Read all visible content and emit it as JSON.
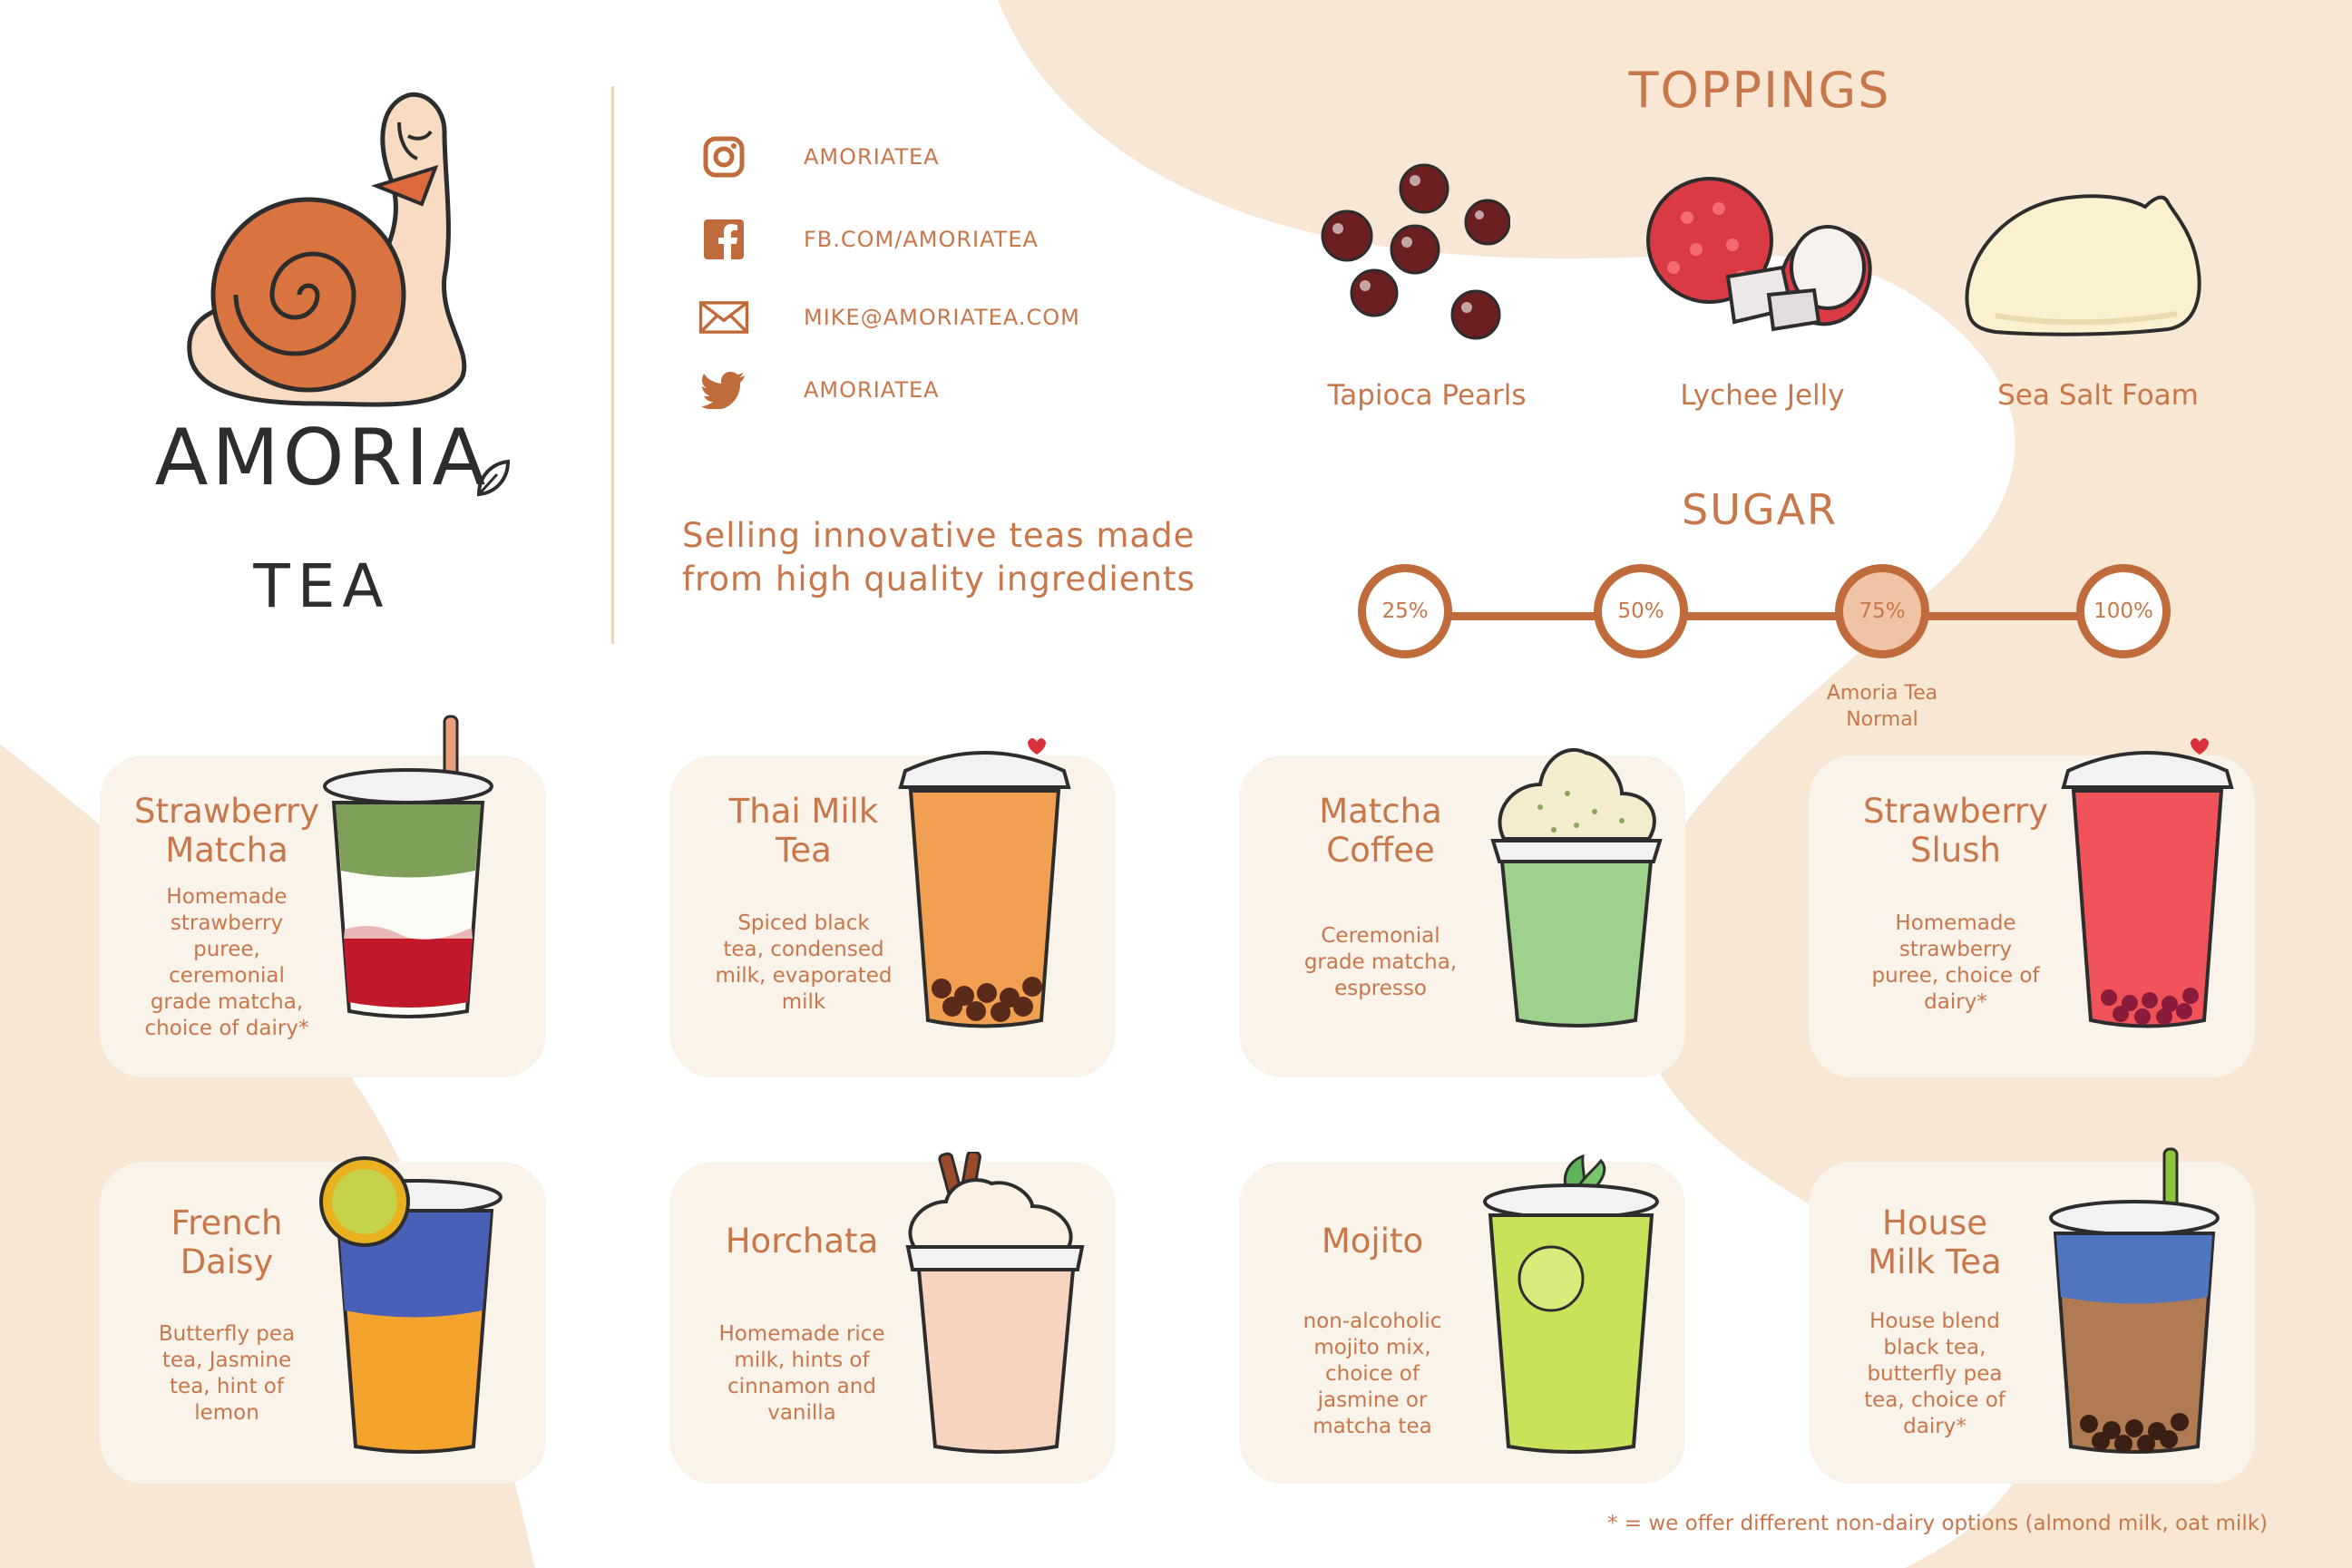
{
  "brand": {
    "name": "AMORIA",
    "sub": "TEA"
  },
  "contacts": {
    "instagram": "AMORIATEA",
    "facebook": "FB.COM/AMORIATEA",
    "email": "MIKE@AMORIATEA.COM",
    "twitter": "AMORIATEA"
  },
  "tagline": {
    "line1": "Selling innovative teas made",
    "line2": "from high quality ingredients"
  },
  "toppings": {
    "heading": "TOPPINGS",
    "items": [
      {
        "label": "Tapioca Pearls",
        "icon": "tapioca-pearls-icon"
      },
      {
        "label": "Lychee Jelly",
        "icon": "lychee-jelly-icon"
      },
      {
        "label": "Sea Salt Foam",
        "icon": "sea-salt-foam-icon"
      }
    ]
  },
  "sugar": {
    "heading": "SUGAR",
    "levels": [
      "25%",
      "50%",
      "75%",
      "100%"
    ],
    "selected_level": "75%",
    "note_line1": "Amoria Tea",
    "note_line2": "Normal"
  },
  "drinks": [
    {
      "title1": "Strawberry",
      "title2": "Matcha",
      "desc": [
        "Homemade",
        "strawberry",
        "puree,",
        "ceremonial",
        "grade matcha,",
        "choice of dairy*"
      ]
    },
    {
      "title1": "Thai Milk",
      "title2": "Tea",
      "desc": [
        "Spiced black",
        "tea, condensed",
        "milk, evaporated",
        "milk"
      ]
    },
    {
      "title1": "Matcha",
      "title2": "Coffee",
      "desc": [
        "Ceremonial",
        "grade matcha,",
        "espresso"
      ]
    },
    {
      "title1": "Strawberry",
      "title2": "Slush",
      "desc": [
        "Homemade",
        "strawberry",
        "puree, choice of",
        "dairy*"
      ]
    },
    {
      "title1": "French",
      "title2": "Daisy",
      "desc": [
        "Butterfly pea",
        "tea, Jasmine",
        "tea, hint of",
        "lemon"
      ]
    },
    {
      "title1": "Horchata",
      "title2": "",
      "desc": [
        "Homemade rice",
        "milk, hints of",
        "cinnamon and",
        "vanilla"
      ]
    },
    {
      "title1": "Mojito",
      "title2": "",
      "desc": [
        "non-alcoholic",
        "mojito mix,",
        "choice of",
        "jasmine or",
        "matcha tea"
      ]
    },
    {
      "title1": "House",
      "title2": "Milk Tea",
      "desc": [
        "House blend",
        "black tea,",
        "butterfly pea",
        "tea, choice of",
        "dairy*"
      ]
    }
  ],
  "footnote": "* = we offer different non-dairy options (almond milk, oat milk)",
  "colors": {
    "accent": "#c8774a",
    "blob": "#f8e7d4",
    "card": "#faf3ea",
    "sugar_line": "#c06b3c"
  }
}
